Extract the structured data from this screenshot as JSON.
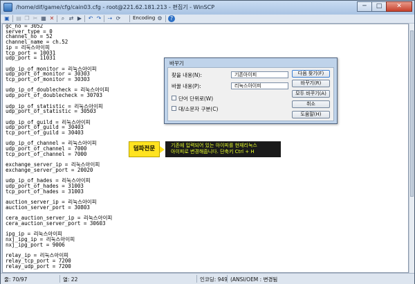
{
  "window": {
    "title": "/home/dif/game/cfg/cain03.cfg - root@221.62.181.213 - 편집기 - WinSCP",
    "buttons": {
      "minimize": "─",
      "maximize": "□",
      "close": "✕"
    }
  },
  "toolbar": {
    "icons": [
      "save-icon",
      "save-all-icon",
      "copy-icon",
      "cut-icon",
      "paste-icon",
      "delete-icon",
      "find-icon",
      "replace-icon",
      "undo-icon",
      "redo-icon",
      "goto-icon"
    ],
    "encoding_label": "Encoding",
    "help_icon": "?"
  },
  "editor": {
    "lines": [
      "gc_no = 3052",
      "server_type = 0",
      "channel_no = 52",
      "channel_name = ch.52",
      "ip = 리눅스아이피",
      "tcp_port = 10031",
      "udp_port = 11031",
      "",
      "udp_ip_of_monitor = 리눅스아이피",
      "udp_port_of_monitor = 30303",
      "tcp_port_of_monitor = 30303",
      "",
      "udp_ip_of_doublecheck = 리눅스아이피",
      "udp_port_of_doublecheck = 30703",
      "",
      "udp_ip_of_statistic = 리눅스아이피",
      "udp_port_of_statistic = 30503",
      "",
      "udp_ip_of_guild = 리눅스아이피",
      "udp_port_of_guild = 30403",
      "tcp_port_of_guild = 30403",
      "",
      "udp_ip_of_channel = 리눅스아이피",
      "udp_port_of_channel = 7000",
      "tcp_port_of_channel = 7000",
      "",
      "exchange_server_ip = 리눅스아이피",
      "exchange_server_port = 20020",
      "",
      "udp_ip_of_hades = 리눅스아이피",
      "udp_port_of_hades = 31003",
      "tcp_port_of_hades = 31003",
      "",
      "auction_server_ip = 리눅스아이피",
      "auction_server_port = 30803",
      "",
      "cera_auction_server_ip = 리눅스아이피",
      "cera_auction_server_port = 30603",
      "",
      "ipg_ip = 리눅스아이피",
      "nxj_ipg_ip = 리눅스아이피",
      "nxj_ipg_port = 9006",
      "",
      "relay_ip = 리눅스아이피",
      "relay_tcp_port = 7200",
      "relay_udp_port = 7200"
    ]
  },
  "status": {
    "line": "줄: 70/97",
    "column": "열: 22",
    "char_code": "인코딩: 949",
    "encoding": "(ANSI/OEM : 변경됨"
  },
  "dialog": {
    "title": "바꾸기",
    "find_label": "찾을 내용(N):",
    "find_value": "기존아이피",
    "replace_label": "바꿀 내용(P):",
    "replace_value": "리눅스아이피",
    "whole_word": "단어 단위로(W)",
    "match_case": "대/소문자 구분(C)",
    "buttons": [
      "다음 찾기(F)",
      "바꾸기(R)",
      "모두 바꾸기(A)",
      "취소",
      "도움말(H)"
    ]
  },
  "callout": {
    "badge": "덤파전문",
    "text": "기존에 입력되어 있는 아이피를 현재리눅스\n아이피로 변경해줍니다. 단축키 Ctrl + H"
  }
}
